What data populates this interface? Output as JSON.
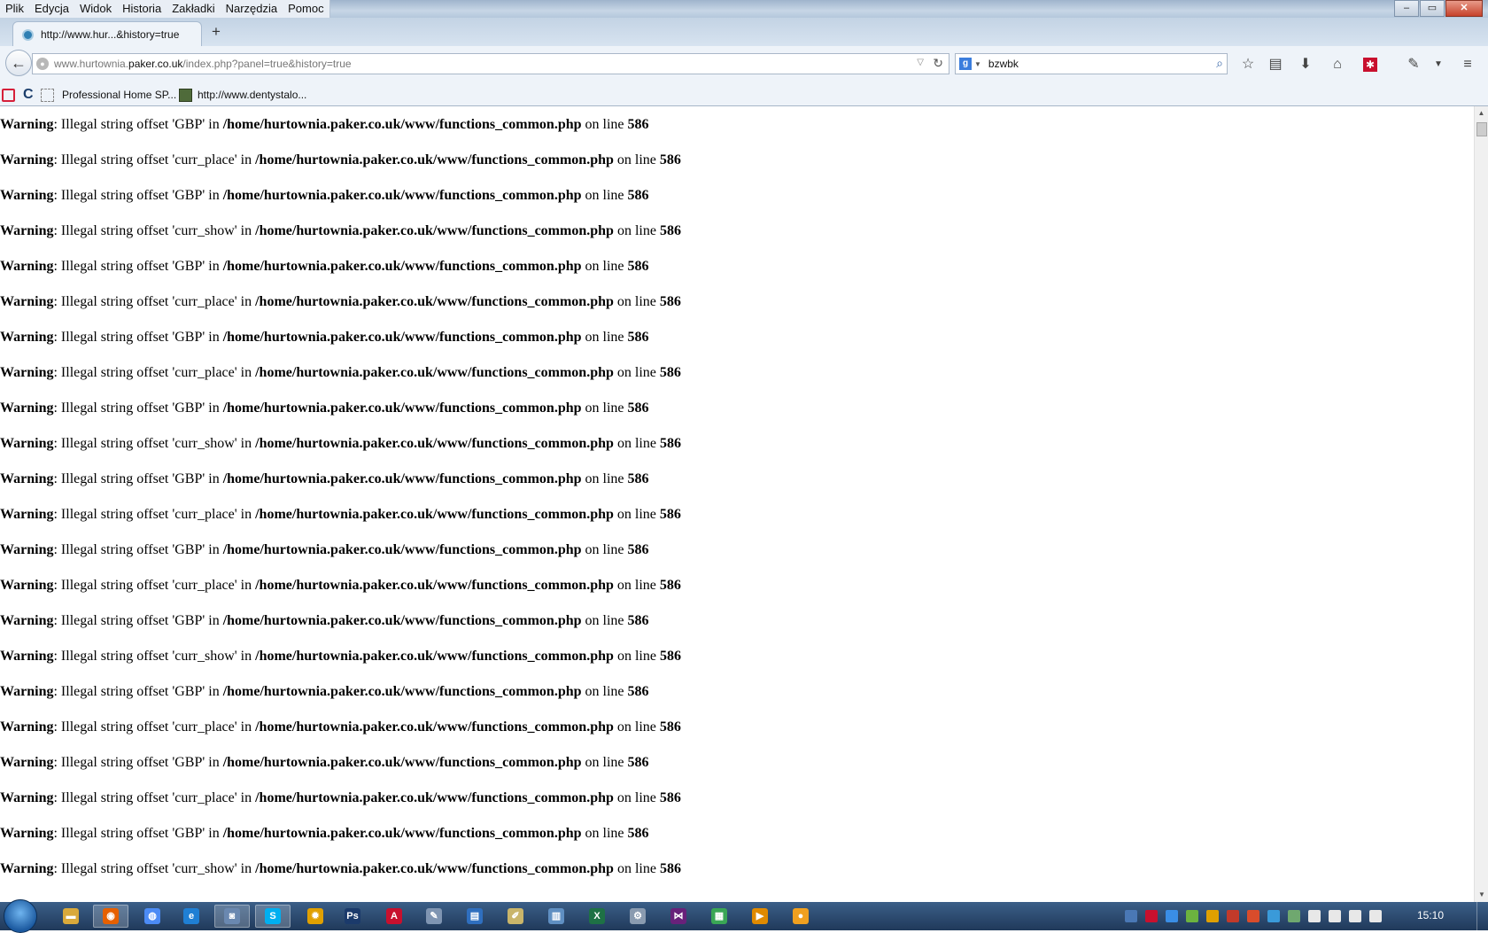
{
  "menu": {
    "items": [
      "Plik",
      "Edycja",
      "Widok",
      "Historia",
      "Zakładki",
      "Narzędzia",
      "Pomoc"
    ]
  },
  "window_controls": {
    "minimize": "–",
    "maximize": "▭",
    "close": "✕"
  },
  "tab": {
    "title": "http://www.hur...&history=true",
    "new_tab": "+"
  },
  "nav": {
    "url_prefix": "www.hurtownia.",
    "url_host": "paker.co.uk",
    "url_path": "/index.php?panel=true&history=true",
    "search_value": "bzwbk",
    "search_engine": "g"
  },
  "bookmarks": [
    {
      "label": ""
    },
    {
      "label": "C"
    },
    {
      "label": ""
    },
    {
      "label": "Professional Home SP..."
    },
    {
      "label": "http://www.dentystalo..."
    }
  ],
  "warnings": [
    {
      "label": "Warning",
      "msg": ": Illegal string offset 'GBP' in ",
      "file": "/home/hurtownia.paker.co.uk/www/functions_common.php",
      "on": " on line ",
      "line": "586"
    },
    {
      "label": "Warning",
      "msg": ": Illegal string offset 'curr_place' in ",
      "file": "/home/hurtownia.paker.co.uk/www/functions_common.php",
      "on": " on line ",
      "line": "586"
    },
    {
      "label": "Warning",
      "msg": ": Illegal string offset 'GBP' in ",
      "file": "/home/hurtownia.paker.co.uk/www/functions_common.php",
      "on": " on line ",
      "line": "586"
    },
    {
      "label": "Warning",
      "msg": ": Illegal string offset 'curr_show' in ",
      "file": "/home/hurtownia.paker.co.uk/www/functions_common.php",
      "on": " on line ",
      "line": "586"
    },
    {
      "label": "Warning",
      "msg": ": Illegal string offset 'GBP' in ",
      "file": "/home/hurtownia.paker.co.uk/www/functions_common.php",
      "on": " on line ",
      "line": "586"
    },
    {
      "label": "Warning",
      "msg": ": Illegal string offset 'curr_place' in ",
      "file": "/home/hurtownia.paker.co.uk/www/functions_common.php",
      "on": " on line ",
      "line": "586"
    },
    {
      "label": "Warning",
      "msg": ": Illegal string offset 'GBP' in ",
      "file": "/home/hurtownia.paker.co.uk/www/functions_common.php",
      "on": " on line ",
      "line": "586"
    },
    {
      "label": "Warning",
      "msg": ": Illegal string offset 'curr_place' in ",
      "file": "/home/hurtownia.paker.co.uk/www/functions_common.php",
      "on": " on line ",
      "line": "586"
    },
    {
      "label": "Warning",
      "msg": ": Illegal string offset 'GBP' in ",
      "file": "/home/hurtownia.paker.co.uk/www/functions_common.php",
      "on": " on line ",
      "line": "586"
    },
    {
      "label": "Warning",
      "msg": ": Illegal string offset 'curr_show' in ",
      "file": "/home/hurtownia.paker.co.uk/www/functions_common.php",
      "on": " on line ",
      "line": "586"
    },
    {
      "label": "Warning",
      "msg": ": Illegal string offset 'GBP' in ",
      "file": "/home/hurtownia.paker.co.uk/www/functions_common.php",
      "on": " on line ",
      "line": "586"
    },
    {
      "label": "Warning",
      "msg": ": Illegal string offset 'curr_place' in ",
      "file": "/home/hurtownia.paker.co.uk/www/functions_common.php",
      "on": " on line ",
      "line": "586"
    },
    {
      "label": "Warning",
      "msg": ": Illegal string offset 'GBP' in ",
      "file": "/home/hurtownia.paker.co.uk/www/functions_common.php",
      "on": " on line ",
      "line": "586"
    },
    {
      "label": "Warning",
      "msg": ": Illegal string offset 'curr_place' in ",
      "file": "/home/hurtownia.paker.co.uk/www/functions_common.php",
      "on": " on line ",
      "line": "586"
    },
    {
      "label": "Warning",
      "msg": ": Illegal string offset 'GBP' in ",
      "file": "/home/hurtownia.paker.co.uk/www/functions_common.php",
      "on": " on line ",
      "line": "586"
    },
    {
      "label": "Warning",
      "msg": ": Illegal string offset 'curr_show' in ",
      "file": "/home/hurtownia.paker.co.uk/www/functions_common.php",
      "on": " on line ",
      "line": "586"
    },
    {
      "label": "Warning",
      "msg": ": Illegal string offset 'GBP' in ",
      "file": "/home/hurtownia.paker.co.uk/www/functions_common.php",
      "on": " on line ",
      "line": "586"
    },
    {
      "label": "Warning",
      "msg": ": Illegal string offset 'curr_place' in ",
      "file": "/home/hurtownia.paker.co.uk/www/functions_common.php",
      "on": " on line ",
      "line": "586"
    },
    {
      "label": "Warning",
      "msg": ": Illegal string offset 'GBP' in ",
      "file": "/home/hurtownia.paker.co.uk/www/functions_common.php",
      "on": " on line ",
      "line": "586"
    },
    {
      "label": "Warning",
      "msg": ": Illegal string offset 'curr_place' in ",
      "file": "/home/hurtownia.paker.co.uk/www/functions_common.php",
      "on": " on line ",
      "line": "586"
    },
    {
      "label": "Warning",
      "msg": ": Illegal string offset 'GBP' in ",
      "file": "/home/hurtownia.paker.co.uk/www/functions_common.php",
      "on": " on line ",
      "line": "586"
    },
    {
      "label": "Warning",
      "msg": ": Illegal string offset 'curr_show' in ",
      "file": "/home/hurtownia.paker.co.uk/www/functions_common.php",
      "on": " on line ",
      "line": "586"
    }
  ],
  "taskbar": {
    "clock": "15:10",
    "apps": [
      {
        "icon": "explorer-icon",
        "color": "#d9a93b",
        "glyph": "▬"
      },
      {
        "icon": "firefox-icon",
        "color": "#e66000",
        "glyph": "◉",
        "active": true
      },
      {
        "icon": "chrome-icon",
        "color": "#4c8bf5",
        "glyph": "◍"
      },
      {
        "icon": "internet-explorer-icon",
        "color": "#1f7fd4",
        "glyph": "e"
      },
      {
        "icon": "remote-desktop-icon",
        "color": "#6a88b0",
        "glyph": "◙",
        "active": true
      },
      {
        "icon": "skype-icon",
        "color": "#00aff0",
        "glyph": "S",
        "active": true
      },
      {
        "icon": "sun-app-icon",
        "color": "#e0a000",
        "glyph": "✹"
      },
      {
        "icon": "photoshop-icon",
        "color": "#1b3a6b",
        "glyph": "Ps"
      },
      {
        "icon": "acrobat-icon",
        "color": "#c8102e",
        "glyph": "A"
      },
      {
        "icon": "notes-app-icon",
        "color": "#7f95b2",
        "glyph": "✎"
      },
      {
        "icon": "document-app-icon",
        "color": "#2f6fbf",
        "glyph": "▤"
      },
      {
        "icon": "notepad-icon",
        "color": "#c9b56a",
        "glyph": "✐"
      },
      {
        "icon": "book-app-icon",
        "color": "#5f8fc2",
        "glyph": "▥"
      },
      {
        "icon": "spreadsheet-icon",
        "color": "#1e7145",
        "glyph": "X"
      },
      {
        "icon": "network-app-icon",
        "color": "#8a9bb0",
        "glyph": "⚙"
      },
      {
        "icon": "visual-studio-icon",
        "color": "#68217a",
        "glyph": "⋈"
      },
      {
        "icon": "image-app-icon",
        "color": "#3aa655",
        "glyph": "▦"
      },
      {
        "icon": "media-player-icon",
        "color": "#e08a00",
        "glyph": "▶"
      },
      {
        "icon": "orange-app-icon",
        "color": "#f0a020",
        "glyph": "●"
      }
    ],
    "tray": [
      "#4a78b5",
      "#c8102e",
      "#3a8ee6",
      "#6cb33f",
      "#e0a000",
      "#c23a2a",
      "#d94c2b",
      "#3a9ad9",
      "#6fa86f",
      "#e8e8e8",
      "#e8e8e8",
      "#e8e8e8",
      "#e8e8e8"
    ]
  }
}
